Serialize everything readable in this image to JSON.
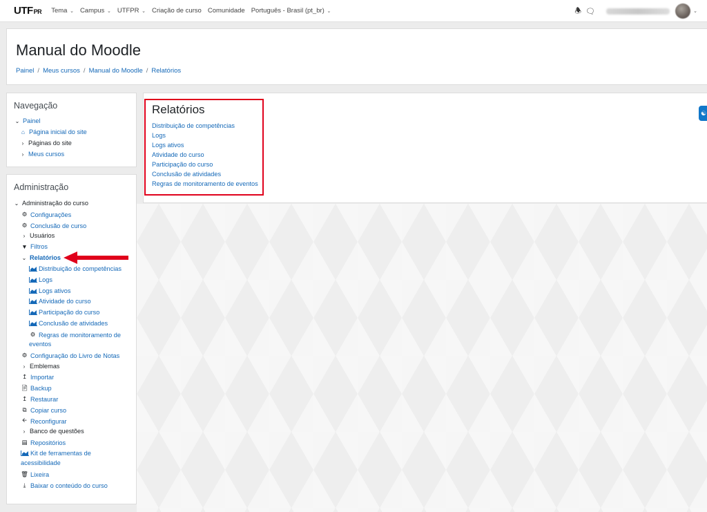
{
  "navbar": {
    "logo_main": "UTF",
    "logo_sub": "PR",
    "menu": [
      {
        "label": "Tema",
        "dropdown": true
      },
      {
        "label": "Campus",
        "dropdown": true
      },
      {
        "label": "UTFPR",
        "dropdown": true
      },
      {
        "label": "Criação de curso",
        "dropdown": false
      },
      {
        "label": "Comunidade",
        "dropdown": false
      },
      {
        "label": "Português - Brasil (pt_br)",
        "dropdown": true
      }
    ],
    "icons": [
      "bell-icon",
      "chat-icon"
    ]
  },
  "header": {
    "title": "Manual do Moodle",
    "breadcrumb": [
      "Painel",
      "Meus cursos",
      "Manual do Moodle",
      "Relatórios"
    ]
  },
  "navigation": {
    "title": "Navegação",
    "root": "Painel",
    "items": [
      "Página inicial do site",
      "Páginas do site",
      "Meus cursos"
    ]
  },
  "administration": {
    "title": "Administração",
    "root": "Administração do curso",
    "items": {
      "configuracoes": "Configurações",
      "conclusao_curso": "Conclusão de curso",
      "usuarios": "Usuários",
      "filtros": "Filtros",
      "relatorios": "Relatórios",
      "reports": [
        "Distribuição de competências",
        "Logs",
        "Logs ativos",
        "Atividade do curso",
        "Participação do curso",
        "Conclusão de atividades"
      ],
      "regras_line1": "Regras de monitoramento de",
      "regras_line2": "eventos",
      "config_notas": "Configuração do Livro de Notas",
      "emblemas": "Emblemas",
      "importar": "Importar",
      "backup": "Backup",
      "restaurar": "Restaurar",
      "copiar": "Copiar curso",
      "reconfigurar": "Reconfigurar",
      "banco_questoes": "Banco de questões",
      "repositorios": "Repositórios",
      "kit_line1": "Kit de ferramentas de",
      "kit_line2": "acessibilidade",
      "lixeira": "Lixeira",
      "baixar": "Baixar o conteúdo do curso"
    }
  },
  "main": {
    "title": "Relatórios",
    "links": [
      "Distribuição de competências",
      "Logs",
      "Logs ativos",
      "Atividade do curso",
      "Participação do curso",
      "Conclusão de atividades",
      "Regras de monitoramento de eventos"
    ]
  },
  "colors": {
    "link": "#1569b8",
    "highlight": "#e0001b",
    "arrow": "#e0001b",
    "side_button": "#1177c9"
  }
}
